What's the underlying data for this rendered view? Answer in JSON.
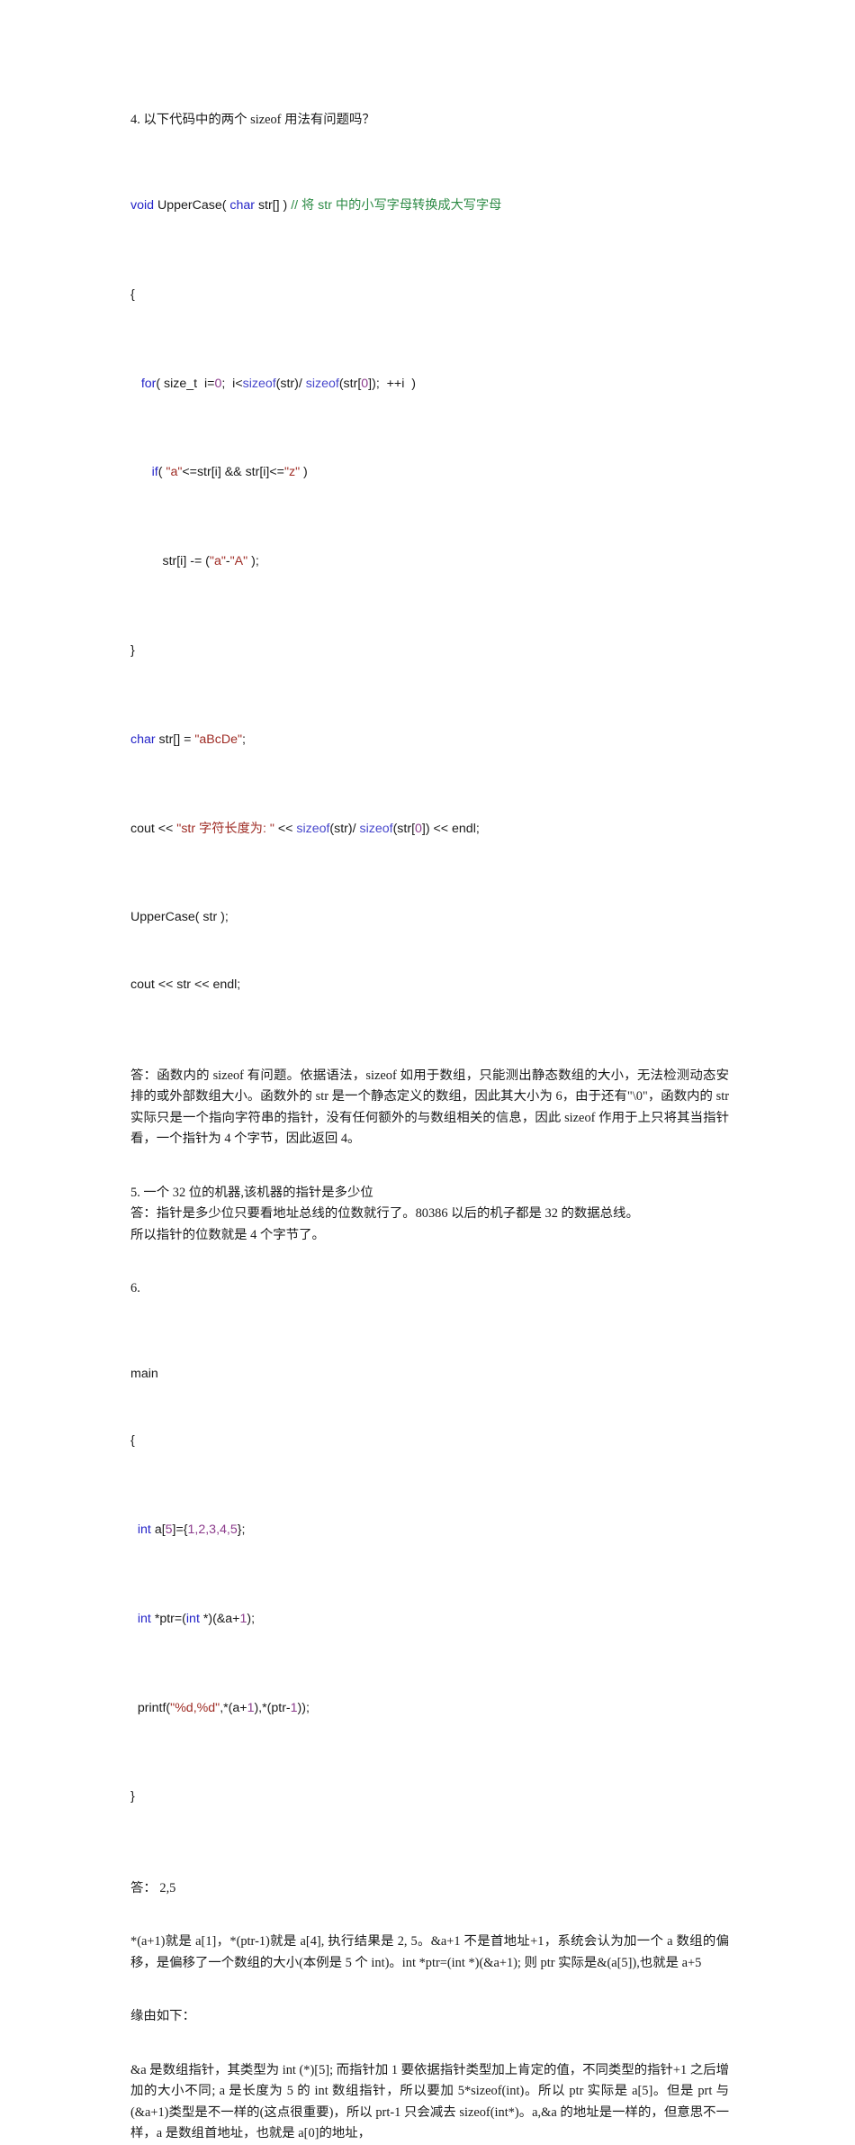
{
  "document": {
    "language": "zh-CN",
    "background_color": "#ffffff",
    "text_color": "#1a1a1a",
    "syntax_colors": {
      "keyword": "#2424c8",
      "string": "#9e2b24",
      "number": "#8b3a8b",
      "comment": "#2e8b46",
      "function": "#4747cc",
      "plain": "#1a1a1a"
    }
  },
  "q4": {
    "heading": "4.  以下代码中的两个  sizeof  用法有问题吗？",
    "code": {
      "l1_kw_void": "void",
      "l1_name": " UpperCase( ",
      "l1_kw_char": "char",
      "l1_args": " str[] ) ",
      "l1_comment": "// 将 str 中的小写字母转换成大写字母",
      "l2": "{",
      "l3_indent": "   ",
      "l3_kw_for": "for",
      "l3_a": "( size_t  i=",
      "l3_zero": "0",
      "l3_b": ";  i<",
      "l3_sizeof1": "sizeof",
      "l3_c": "(str)/ ",
      "l3_sizeof2": "sizeof",
      "l3_d": "(str[",
      "l3_zero2": "0",
      "l3_e": "]);  ++i  )",
      "l4_indent": "      ",
      "l4_kw_if": "if",
      "l4_a": "( ",
      "l4_s1": "\"a\"",
      "l4_b": "<=str[i] && str[i]<=",
      "l4_s2": "\"z\"",
      "l4_c": " )",
      "l5_indent": "         ",
      "l5_a": "str[i] -= (",
      "l5_s1": "\"a\"",
      "l5_b": "-",
      "l5_s2": "\"A\"",
      "l5_c": " );",
      "l6": "}",
      "l7_kw_char": "char",
      "l7_a": " str[] = ",
      "l7_str": "\"aBcDe\"",
      "l7_b": ";",
      "l8_a": "cout << ",
      "l8_str": "\"str 字符长度为: \"",
      "l8_b": " << ",
      "l8_sizeof1": "sizeof",
      "l8_c": "(str)/ ",
      "l8_sizeof2": "sizeof",
      "l8_d": "(str[",
      "l8_zero": "0",
      "l8_e": "]) << endl;",
      "l9": "UpperCase( str );",
      "l10": "cout << str << endl;"
    },
    "answer": "答：函数内的 sizeof 有问题。依据语法，sizeof 如用于数组，只能测出静态数组的大小，无法检测动态安排的或外部数组大小。函数外的 str 是一个静态定义的数组，因此其大小为 6，由于还有\"\\0\"，函数内的 str 实际只是一个指向字符串的指针，没有任何额外的与数组相关的信息，因此 sizeof 作用于上只将其当指针看，一个指针为 4 个字节，因此返回 4。"
  },
  "q5": {
    "heading": "5.  一个  32  位的机器,该机器的指针是多少位",
    "answer_line1": "答：指针是多少位只要看地址总线的位数就行了。80386 以后的机子都是 32 的数据总线。",
    "answer_line2": "所以指针的位数就是 4 个字节了。"
  },
  "q6": {
    "heading": "6.",
    "code": {
      "l1": "main",
      "l2": "{",
      "l3_indent": "  ",
      "l3_kw_int": "int",
      "l3_a": " a[",
      "l3_five": "5",
      "l3_b": "]={",
      "l3_nums": "1,2,3,4,5",
      "l3_c": "};",
      "l4_indent": "  ",
      "l4_kw_int1": "int",
      "l4_a": " *ptr=(",
      "l4_kw_int2": "int",
      "l4_b": " *)(&a+",
      "l4_one": "1",
      "l4_c": ");",
      "l5_indent": "  ",
      "l5_a": "printf(",
      "l5_str": "\"%d,%d\"",
      "l5_b": ",*(a+",
      "l5_one": "1",
      "l5_c": "),*(ptr-",
      "l5_one2": "1",
      "l5_d": "));",
      "l6": "}"
    },
    "answer": "答： 2,5",
    "explain1": "*(a+1)就是 a[1]，*(ptr-1)就是 a[4], 执行结果是 2, 5。&a+1 不是首地址+1，系统会认为加一个 a 数组的偏移，是偏移了一个数组的大小(本例是 5 个 int)。int *ptr=(int *)(&a+1); 则 ptr 实际是&(a[5]),也就是 a+5",
    "reason_label": "缘由如下：",
    "explain2": "&a 是数组指针，其类型为 int (*)[5]; 而指针加 1 要依据指针类型加上肯定的值，不同类型的指针+1 之后增加的大小不同; a 是长度为 5 的 int 数组指针，所以要加 5*sizeof(int)。所以 ptr 实际是 a[5]。但是 prt 与(&a+1)类型是不一样的(这点很重要)，所以 prt-1 只会减去 sizeof(int*)。a,&a 的地址是一样的，但意思不一样，a 是数组首地址，也就是 a[0]的地址，"
  }
}
